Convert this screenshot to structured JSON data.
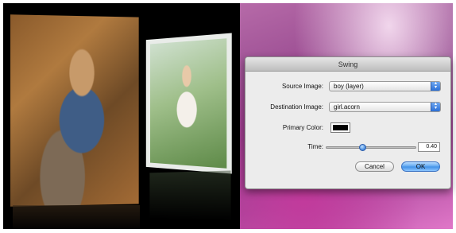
{
  "dialog": {
    "title": "Swing",
    "source_label": "Source Image:",
    "source_value": "boy (layer)",
    "destination_label": "Destination Image:",
    "destination_value": "girl.acorn",
    "primary_color_label": "Primary Color:",
    "primary_color": "#000000",
    "time_label": "Time:",
    "time_value": "0.40",
    "time_fraction": 0.4,
    "cancel_label": "Cancel",
    "ok_label": "OK"
  }
}
